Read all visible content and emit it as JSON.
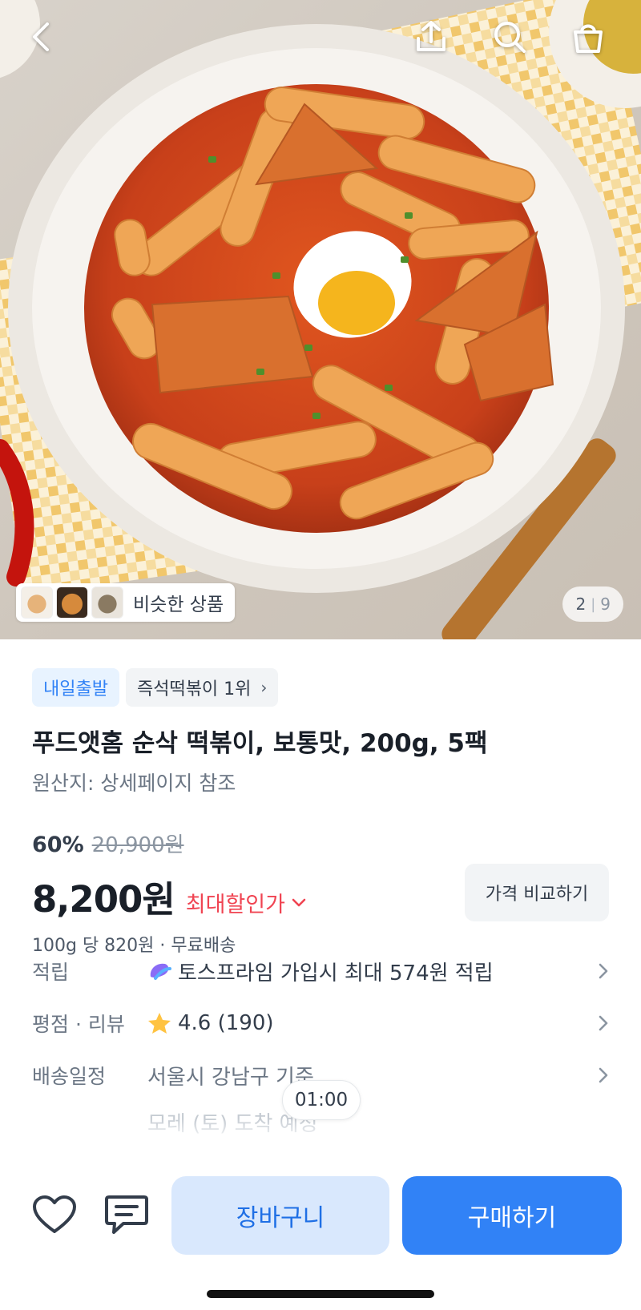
{
  "topbar": {
    "back_icon": "chevron-left-icon",
    "share_icon": "share-icon",
    "search_icon": "search-icon",
    "cart_icon": "shopping-bag-icon"
  },
  "gallery": {
    "similar_label": "비슷한 상품",
    "page_current": "2",
    "page_total": "9"
  },
  "product": {
    "badges": [
      "내일출발",
      "즉석떡볶이 1위"
    ],
    "title": "푸드앳홈 순삭 떡볶이, 보통맛, 200g, 5팩",
    "origin": "원산지: 상세페이지 참조",
    "discount_rate": "60%",
    "original_price": "20,900원",
    "price": "8,200원",
    "max_discount_label": "최대할인가",
    "compare_label": "가격 비교하기",
    "unit_price_line": "100g 당 820원 · 무료배송"
  },
  "info": {
    "points_label": "적립",
    "points_value": "토스프라임 가입시 최대 574원 적립",
    "rating_label": "평점 · 리뷰",
    "rating_value": "4.6 (190)",
    "delivery_label": "배송일정",
    "delivery_value": "서울시 강남구 기준",
    "delivery_value_2": "모레 (토) 도착 예정"
  },
  "overlay": {
    "timer": "01:00"
  },
  "bottom": {
    "cart_button": "장바구니",
    "buy_button": "구매하기"
  },
  "colors": {
    "accent": "#3182f6",
    "accent_light": "#d9e8fd",
    "sale_red": "#f04452",
    "star": "#ffc342"
  }
}
